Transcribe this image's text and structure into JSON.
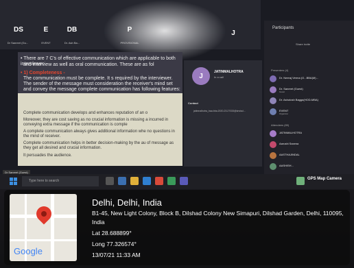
{
  "meeting": {
    "tiles": [
      {
        "initials": "DS",
        "name": "Dr Sanreet (Gu...",
        "color": "#8b6f9c"
      },
      {
        "initials": "E",
        "name": "EVENT",
        "color": "#6f7fb0"
      },
      {
        "initials": "DB",
        "name": "Dr. Ash Ba...",
        "color": "#7c6aa8"
      },
      {
        "initials": "P",
        "name": "PROVISIONAL",
        "color": "#9d7ec4"
      },
      {
        "initials": "J",
        "name": "",
        "color": "#a77cc9"
      }
    ],
    "slide": {
      "line1": "• There are 7 C's of effective communication which are applicable to both interviewer",
      "line2": "and interview as well as oral communication. These are as fol",
      "point_title": "• 1) Completeness - ",
      "point_text": "The communication must be complete. It s required by the interviewer. The sender of the message must consideration the receiver's mind set and convey the message complete communication has following features:",
      "bullets": [
        "Complete communication develops and enhances reputation of an o",
        "Moreover, they are cost saving as no crucial information is missing a incurred in conveying extra message if the communication is comple",
        "A complete communication always gives additional information whe no questions in the mind of receiver.",
        "Complete communication helps in better decision-making by the au of message as they get all desired and crucial information.",
        "It persuades the audience."
      ]
    },
    "profile": {
      "initial": "J",
      "name": "JATINMALHOTRA",
      "subtitle": "In a call",
      "contact_label": "Contact",
      "email": "jatinmalhotra_baa.bba.2020-23.27033@knvisd..."
    },
    "panel": {
      "title": "Participants",
      "share": "Share invite",
      "presenters_label": "Presenters (4)",
      "attendees_label": "Attendees (89)",
      "presenters": [
        {
          "name": "Dr. Neeraj Verma (O...BBA(M)...",
          "sub": "",
          "color": "#7e6cb2"
        },
        {
          "name": "Dr. Sanreet (Guest)",
          "sub": "Guest",
          "color": "#9a7bbf"
        },
        {
          "name": "Dr. Ashutosh Bagga(HOD-MBA)",
          "sub": "",
          "color": "#8f85b8"
        },
        {
          "name": "EVENT",
          "sub": "Organizer",
          "color": "#6f7fb0"
        }
      ],
      "attendees": [
        {
          "name": "JATINMALHOTRA",
          "color": "#a77cc9"
        },
        {
          "name": "Aarushi Saxena",
          "color": "#c44a6d"
        },
        {
          "name": "AASTHAJINDAL",
          "color": "#b8743f"
        },
        {
          "name": "AASHISH...",
          "color": "#5e8f6f"
        }
      ]
    },
    "presenter_tag": "Dr Sanreet (Guest)"
  },
  "taskbar": {
    "search_placeholder": "Type here to search",
    "watermark": "GPS Map Camera"
  },
  "gps": {
    "title": "Delhi, Delhi, India",
    "address": "B1-45, New Light Colony, Block B, Dilshad Colony New Simapuri, Dilshad Garden, Delhi, 110095, India",
    "lat": "Lat 28.688899°",
    "long": "Long 77.326574°",
    "datetime": "13/07/21 11:33 AM",
    "map_logo": "Google"
  },
  "colors": {
    "pin": "#e0392b",
    "slide_bg": "#dcd9c6",
    "panel_bg": "#222229"
  }
}
